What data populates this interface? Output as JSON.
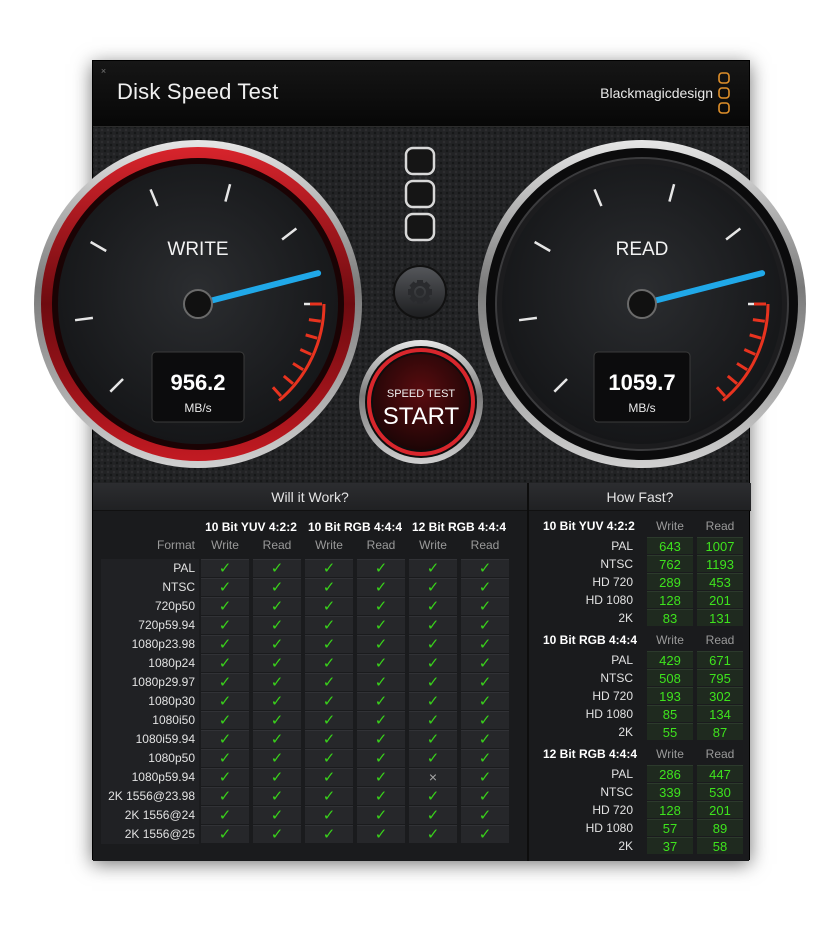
{
  "window": {
    "title": "Disk Speed Test",
    "brand": "Blackmagicdesign",
    "close_glyph": "×",
    "brand_logo_icon": "blackmagic-logo-icon"
  },
  "colors": {
    "needle": "#20a8e8",
    "write_bezel": "#b3141b",
    "ok_check": "#39d11b",
    "value_green": "#3ee41d"
  },
  "gauges": {
    "write": {
      "label": "WRITE",
      "value": "956.2",
      "unit": "MB/s",
      "needle_fraction": 0.78
    },
    "read": {
      "label": "READ",
      "value": "1059.7",
      "unit": "MB/s",
      "needle_fraction": 0.78
    }
  },
  "start_button": {
    "caption": "SPEED TEST",
    "label": "START"
  },
  "settings_icon": "gear-icon",
  "will_it_work": {
    "title": "Will it Work?",
    "format_header": "Format",
    "groups": [
      "10 Bit YUV 4:2:2",
      "10 Bit RGB 4:4:4",
      "12 Bit RGB 4:4:4"
    ],
    "subheaders": [
      "Write",
      "Read"
    ],
    "rows": [
      {
        "format": "PAL",
        "cells": [
          "ok",
          "ok",
          "ok",
          "ok",
          "ok",
          "ok"
        ]
      },
      {
        "format": "NTSC",
        "cells": [
          "ok",
          "ok",
          "ok",
          "ok",
          "ok",
          "ok"
        ]
      },
      {
        "format": "720p50",
        "cells": [
          "ok",
          "ok",
          "ok",
          "ok",
          "ok",
          "ok"
        ]
      },
      {
        "format": "720p59.94",
        "cells": [
          "ok",
          "ok",
          "ok",
          "ok",
          "ok",
          "ok"
        ]
      },
      {
        "format": "1080p23.98",
        "cells": [
          "ok",
          "ok",
          "ok",
          "ok",
          "ok",
          "ok"
        ]
      },
      {
        "format": "1080p24",
        "cells": [
          "ok",
          "ok",
          "ok",
          "ok",
          "ok",
          "ok"
        ]
      },
      {
        "format": "1080p29.97",
        "cells": [
          "ok",
          "ok",
          "ok",
          "ok",
          "ok",
          "ok"
        ]
      },
      {
        "format": "1080p30",
        "cells": [
          "ok",
          "ok",
          "ok",
          "ok",
          "ok",
          "ok"
        ]
      },
      {
        "format": "1080i50",
        "cells": [
          "ok",
          "ok",
          "ok",
          "ok",
          "ok",
          "ok"
        ]
      },
      {
        "format": "1080i59.94",
        "cells": [
          "ok",
          "ok",
          "ok",
          "ok",
          "ok",
          "ok"
        ]
      },
      {
        "format": "1080p50",
        "cells": [
          "ok",
          "ok",
          "ok",
          "ok",
          "ok",
          "ok"
        ]
      },
      {
        "format": "1080p59.94",
        "cells": [
          "ok",
          "ok",
          "ok",
          "ok",
          "no",
          "ok"
        ]
      },
      {
        "format": "2K 1556@23.98",
        "cells": [
          "ok",
          "ok",
          "ok",
          "ok",
          "ok",
          "ok"
        ]
      },
      {
        "format": "2K 1556@24",
        "cells": [
          "ok",
          "ok",
          "ok",
          "ok",
          "ok",
          "ok"
        ]
      },
      {
        "format": "2K 1556@25",
        "cells": [
          "ok",
          "ok",
          "ok",
          "ok",
          "ok",
          "ok"
        ]
      }
    ],
    "ok_glyph": "✓",
    "no_glyph": "×"
  },
  "how_fast": {
    "title": "How Fast?",
    "col_headers": [
      "Write",
      "Read"
    ],
    "groups": [
      {
        "name": "10 Bit YUV 4:2:2",
        "rows": [
          {
            "label": "PAL",
            "write": "643",
            "read": "1007"
          },
          {
            "label": "NTSC",
            "write": "762",
            "read": "1193"
          },
          {
            "label": "HD 720",
            "write": "289",
            "read": "453"
          },
          {
            "label": "HD 1080",
            "write": "128",
            "read": "201"
          },
          {
            "label": "2K",
            "write": "83",
            "read": "131"
          }
        ]
      },
      {
        "name": "10 Bit RGB 4:4:4",
        "rows": [
          {
            "label": "PAL",
            "write": "429",
            "read": "671"
          },
          {
            "label": "NTSC",
            "write": "508",
            "read": "795"
          },
          {
            "label": "HD 720",
            "write": "193",
            "read": "302"
          },
          {
            "label": "HD 1080",
            "write": "85",
            "read": "134"
          },
          {
            "label": "2K",
            "write": "55",
            "read": "87"
          }
        ]
      },
      {
        "name": "12 Bit RGB 4:4:4",
        "rows": [
          {
            "label": "PAL",
            "write": "286",
            "read": "447"
          },
          {
            "label": "NTSC",
            "write": "339",
            "read": "530"
          },
          {
            "label": "HD 720",
            "write": "128",
            "read": "201"
          },
          {
            "label": "HD 1080",
            "write": "57",
            "read": "89"
          },
          {
            "label": "2K",
            "write": "37",
            "read": "58"
          }
        ]
      }
    ]
  }
}
